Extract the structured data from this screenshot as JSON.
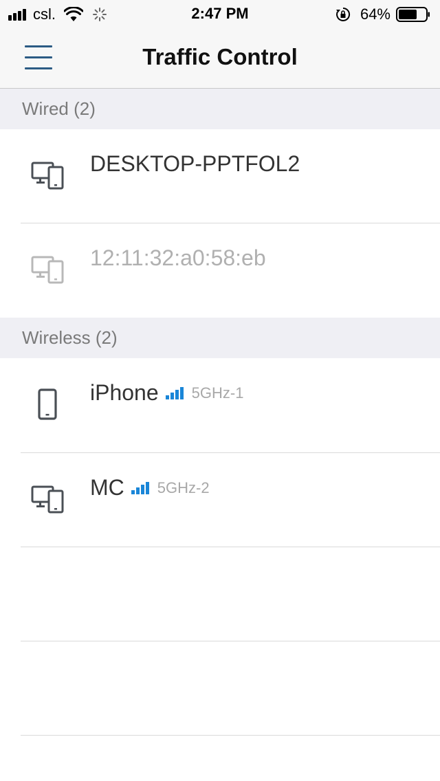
{
  "status_bar": {
    "carrier": "csl.",
    "time": "2:47 PM",
    "battery": "64%"
  },
  "nav": {
    "title": "Traffic Control",
    "menu_icon": "hamburger-menu-icon"
  },
  "sections": {
    "wired": {
      "header": "Wired (2)",
      "devices": [
        {
          "name": "DESKTOP-PPTFOL2",
          "icon": "desktop-phone-icon",
          "online": true
        },
        {
          "name": "12:11:32:a0:58:eb",
          "icon": "desktop-phone-icon",
          "online": false
        }
      ]
    },
    "wireless": {
      "header": "Wireless (2)",
      "devices": [
        {
          "name": "iPhone",
          "band": "5GHz-1",
          "icon": "phone-icon",
          "signal_icon": "signal-strength-icon"
        },
        {
          "name": "MC",
          "band": "5GHz-2",
          "icon": "desktop-phone-icon",
          "signal_icon": "signal-strength-icon"
        }
      ]
    }
  },
  "colors": {
    "accent": "#1a86d8",
    "menu_icon": "#2b5b84",
    "section_bg": "#efeff4",
    "offline_text": "#b0b0b0"
  }
}
